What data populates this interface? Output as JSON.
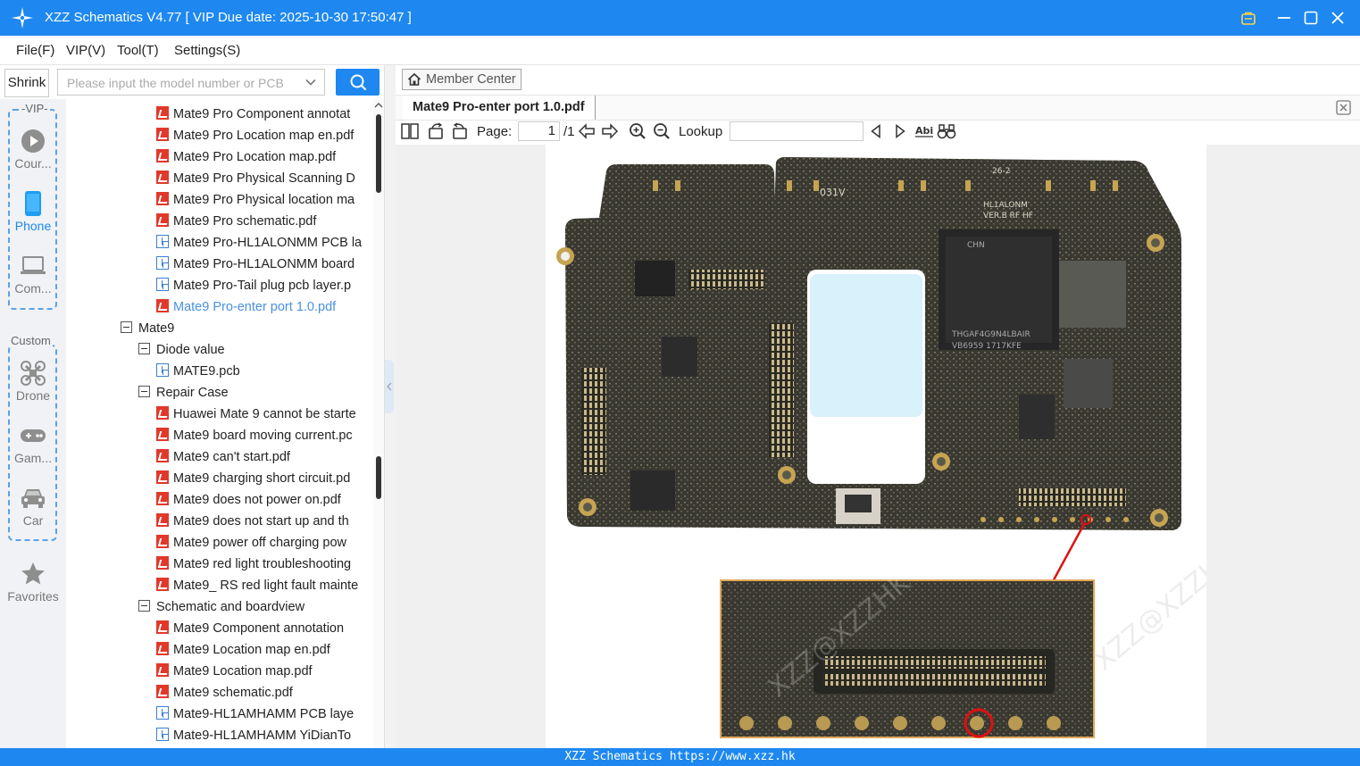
{
  "app": {
    "title": "XZZ Schematics V4.77 [ VIP Due date: 2025-10-30 17:50:47 ]",
    "accent": "#1e88f0"
  },
  "menu": [
    "File(F)",
    "VIP(V)",
    "Tool(T)",
    "Settings(S)"
  ],
  "search": {
    "shrink_label": "Shrink",
    "placeholder": "Please input the model number or PCB",
    "value": ""
  },
  "leftnav": {
    "vip_label": "-VIP-",
    "custom_label": "Custom",
    "items": [
      {
        "label": "Cour...",
        "icon": "play-icon"
      },
      {
        "label": "Phone",
        "icon": "phone-icon"
      },
      {
        "label": "Com...",
        "icon": "laptop-icon"
      },
      {
        "label": "Drone",
        "icon": "drone-icon"
      },
      {
        "label": "Gam...",
        "icon": "gamepad-icon"
      },
      {
        "label": "Car",
        "icon": "car-icon"
      },
      {
        "label": "Favorites",
        "icon": "star-icon"
      }
    ]
  },
  "tree": [
    {
      "text": "Mate9 Pro Component annotat",
      "type": "pdf",
      "level": 2
    },
    {
      "text": "Mate9 Pro Location map en.pdf",
      "type": "pdf",
      "level": 2
    },
    {
      "text": "Mate9 Pro Location map.pdf",
      "type": "pdf",
      "level": 2
    },
    {
      "text": "Mate9 Pro Physical Scanning D",
      "type": "pdf",
      "level": 2
    },
    {
      "text": "Mate9 Pro Physical location ma",
      "type": "pdf",
      "level": 2
    },
    {
      "text": "Mate9 Pro schematic.pdf",
      "type": "pdf",
      "level": 2
    },
    {
      "text": "Mate9 Pro-HL1ALONMM PCB la",
      "type": "pcb",
      "level": 2
    },
    {
      "text": "Mate9 Pro-HL1ALONMM board",
      "type": "pcb",
      "level": 2
    },
    {
      "text": "Mate9 Pro-Tail plug pcb layer.p",
      "type": "pcb",
      "level": 2
    },
    {
      "text": "Mate9 Pro-enter port 1.0.pdf",
      "type": "pdf",
      "level": 2,
      "selected": true
    },
    {
      "text": "Mate9",
      "type": "folder",
      "level": 0
    },
    {
      "text": "Diode value",
      "type": "folder",
      "level": 1
    },
    {
      "text": "MATE9.pcb",
      "type": "pcb",
      "level": 2
    },
    {
      "text": "Repair Case",
      "type": "folder",
      "level": 1
    },
    {
      "text": "Huawei Mate 9 cannot be starte",
      "type": "pdf",
      "level": 2
    },
    {
      "text": "Mate9 board moving current.pc",
      "type": "pdf",
      "level": 2
    },
    {
      "text": "Mate9 can't start.pdf",
      "type": "pdf",
      "level": 2
    },
    {
      "text": "Mate9 charging short circuit.pd",
      "type": "pdf",
      "level": 2
    },
    {
      "text": "Mate9 does not power on.pdf",
      "type": "pdf",
      "level": 2
    },
    {
      "text": "Mate9 does not start up and th",
      "type": "pdf",
      "level": 2
    },
    {
      "text": "Mate9 power off charging pow",
      "type": "pdf",
      "level": 2
    },
    {
      "text": "Mate9 red light troubleshooting",
      "type": "pdf",
      "level": 2
    },
    {
      "text": "Mate9_ RS red light fault mainte",
      "type": "pdf",
      "level": 2
    },
    {
      "text": "Schematic and boardview",
      "type": "folder",
      "level": 1
    },
    {
      "text": "Mate9 Component annotation",
      "type": "pdf",
      "level": 2
    },
    {
      "text": "Mate9 Location map en.pdf",
      "type": "pdf",
      "level": 2
    },
    {
      "text": "Mate9 Location map.pdf",
      "type": "pdf",
      "level": 2
    },
    {
      "text": "Mate9 schematic.pdf",
      "type": "pdf",
      "level": 2
    },
    {
      "text": "Mate9-HL1AMHAMM PCB laye",
      "type": "pcb",
      "level": 2
    },
    {
      "text": "Mate9-HL1AMHAMM YiDianTo",
      "type": "pcb",
      "level": 2
    }
  ],
  "member_center": "Member Center",
  "doc_tab": "Mate9 Pro-enter port 1.0.pdf",
  "toolbar": {
    "page_label": "Page:",
    "page_value": "1",
    "page_total": "/1",
    "lookup_label": "Lookup",
    "lookup_value": ""
  },
  "document": {
    "chip_labels": [
      "031V",
      "CHN",
      "THGAF4G9N4LBAIR",
      "VB6959 1717KFE",
      "26-2",
      "HL1ALONM",
      "VER.B RF HF"
    ],
    "watermark": "XZZ@XZZHK"
  },
  "footer": "XZZ Schematics https://www.xzz.hk"
}
